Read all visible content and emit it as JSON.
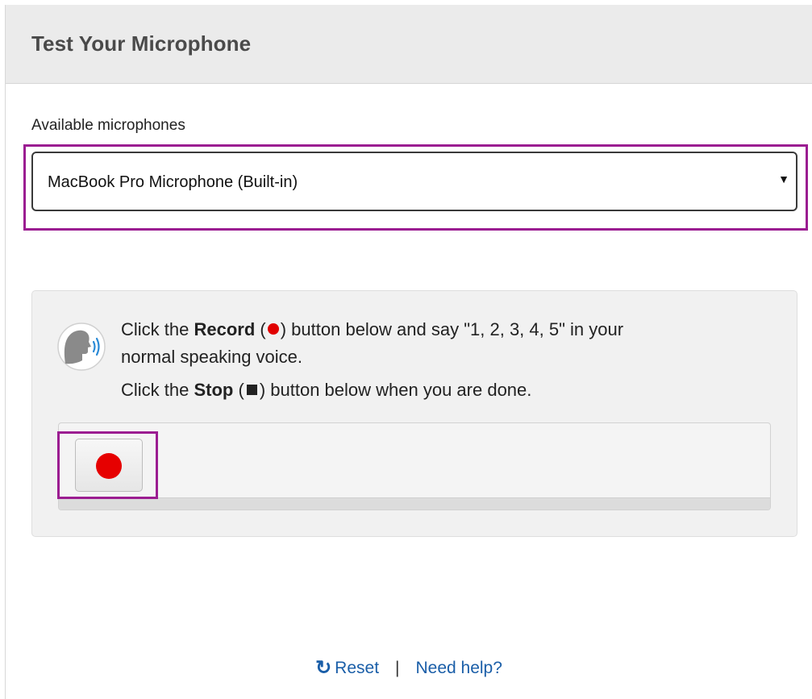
{
  "header": {
    "title": "Test Your Microphone"
  },
  "microphone": {
    "label": "Available microphones",
    "selected": "MacBook Pro Microphone (Built-in)",
    "dropdown_icon": "triangle-down-icon"
  },
  "instructions": {
    "line1_pre": "Click the ",
    "line1_bold": "Record",
    "line1_post": " button below and say \"1, 2, 3, 4, 5\" in your",
    "line2": "normal speaking voice.",
    "line3_pre": "Click the ",
    "line3_bold": "Stop",
    "line3_post": " button below when you are done.",
    "speaker_icon": "speaking-head-icon"
  },
  "recorder": {
    "record_icon": "record-dot-icon",
    "record_color": "#e60000"
  },
  "footer": {
    "reset_label": "Reset",
    "reset_icon": "refresh-icon",
    "separator": "|",
    "help_label": "Need help?"
  },
  "colors": {
    "highlight": "#9b1d91",
    "link": "#1a5ea8",
    "header_bg": "#ebebeb"
  }
}
